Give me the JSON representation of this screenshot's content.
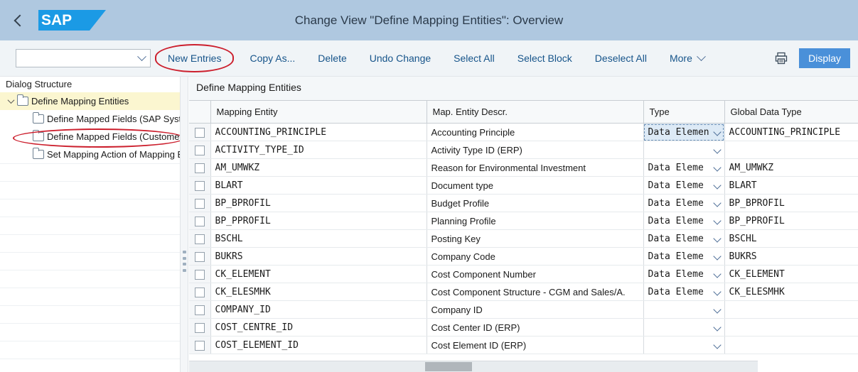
{
  "shell": {
    "back_icon": "back-chevron-icon",
    "logo_text": "SAP",
    "title": "Change View \"Define Mapping Entities\": Overview"
  },
  "toolbar": {
    "variant_select_value": "",
    "variant_select_icon": "chevron-down-icon",
    "buttons": [
      {
        "label": "New Entries",
        "highlighted": true
      },
      {
        "label": "Copy As...",
        "highlighted": false
      },
      {
        "label": "Delete",
        "highlighted": false
      },
      {
        "label": "Undo Change",
        "highlighted": false
      },
      {
        "label": "Select All",
        "highlighted": false
      },
      {
        "label": "Select Block",
        "highlighted": false
      },
      {
        "label": "Deselect All",
        "highlighted": false
      }
    ],
    "more_label": "More",
    "more_icon": "chevron-down-icon",
    "print_icon": "printer-icon",
    "display_label": "Display",
    "display_color": "#4a90d9",
    "highlight_color": "#cc1f2d"
  },
  "sidebar": {
    "title": "Dialog Structure",
    "nodes": [
      {
        "label": "Define Mapping Entities",
        "level": 0,
        "selected": true,
        "expanded": true,
        "highlighted": false
      },
      {
        "label": "Define Mapped Fields (SAP Syst",
        "level": 1,
        "selected": false,
        "expanded": false,
        "highlighted": false
      },
      {
        "label": "Define Mapped Fields (Customer",
        "level": 1,
        "selected": false,
        "expanded": false,
        "highlighted": true
      },
      {
        "label": "Set Mapping Action of Mapping E",
        "level": 1,
        "selected": false,
        "expanded": false,
        "highlighted": false
      }
    ]
  },
  "content": {
    "title": "Define Mapping Entities",
    "columns": [
      "Mapping Entity",
      "Map. Entity Descr.",
      "Type",
      "Global Data Type"
    ],
    "rows": [
      {
        "checked": false,
        "entity": "ACCOUNTING_PRINCIPLE",
        "descr": "Accounting Principle",
        "type": "Data Elemen",
        "type_full": "Data Element",
        "gdt": "ACCOUNTING_PRINCIPLE",
        "focused": true
      },
      {
        "checked": false,
        "entity": "ACTIVITY_TYPE_ID",
        "descr": "Activity Type ID (ERP)",
        "type": "",
        "type_full": "",
        "gdt": "",
        "focused": false
      },
      {
        "checked": false,
        "entity": "AM_UMWKZ",
        "descr": "Reason for Environmental Investment",
        "type": "Data Eleme",
        "type_full": "Data Element",
        "gdt": "AM_UMWKZ",
        "focused": false
      },
      {
        "checked": false,
        "entity": "BLART",
        "descr": "Document type",
        "type": "Data Eleme",
        "type_full": "Data Element",
        "gdt": "BLART",
        "focused": false
      },
      {
        "checked": false,
        "entity": "BP_BPROFIL",
        "descr": "Budget Profile",
        "type": "Data Eleme",
        "type_full": "Data Element",
        "gdt": "BP_BPROFIL",
        "focused": false
      },
      {
        "checked": false,
        "entity": "BP_PPROFIL",
        "descr": "Planning Profile",
        "type": "Data Eleme",
        "type_full": "Data Element",
        "gdt": "BP_PPROFIL",
        "focused": false
      },
      {
        "checked": false,
        "entity": "BSCHL",
        "descr": "Posting Key",
        "type": "Data Eleme",
        "type_full": "Data Element",
        "gdt": "BSCHL",
        "focused": false
      },
      {
        "checked": false,
        "entity": "BUKRS",
        "descr": "Company Code",
        "type": "Data Eleme",
        "type_full": "Data Element",
        "gdt": "BUKRS",
        "focused": false
      },
      {
        "checked": false,
        "entity": "CK_ELEMENT",
        "descr": "Cost Component Number",
        "type": "Data Eleme",
        "type_full": "Data Element",
        "gdt": "CK_ELEMENT",
        "focused": false
      },
      {
        "checked": false,
        "entity": "CK_ELESMHK",
        "descr": "Cost Component Structure - CGM and Sales/A.",
        "type": "Data Eleme",
        "type_full": "Data Element",
        "gdt": "CK_ELESMHK",
        "focused": false
      },
      {
        "checked": false,
        "entity": "COMPANY_ID",
        "descr": "Company ID",
        "type": "",
        "type_full": "",
        "gdt": "",
        "focused": false
      },
      {
        "checked": false,
        "entity": "COST_CENTRE_ID",
        "descr": "Cost Center ID (ERP)",
        "type": "",
        "type_full": "",
        "gdt": "",
        "focused": false
      },
      {
        "checked": false,
        "entity": "COST_ELEMENT_ID",
        "descr": "Cost Element ID (ERP)",
        "type": "",
        "type_full": "",
        "gdt": "",
        "focused": false
      }
    ]
  }
}
